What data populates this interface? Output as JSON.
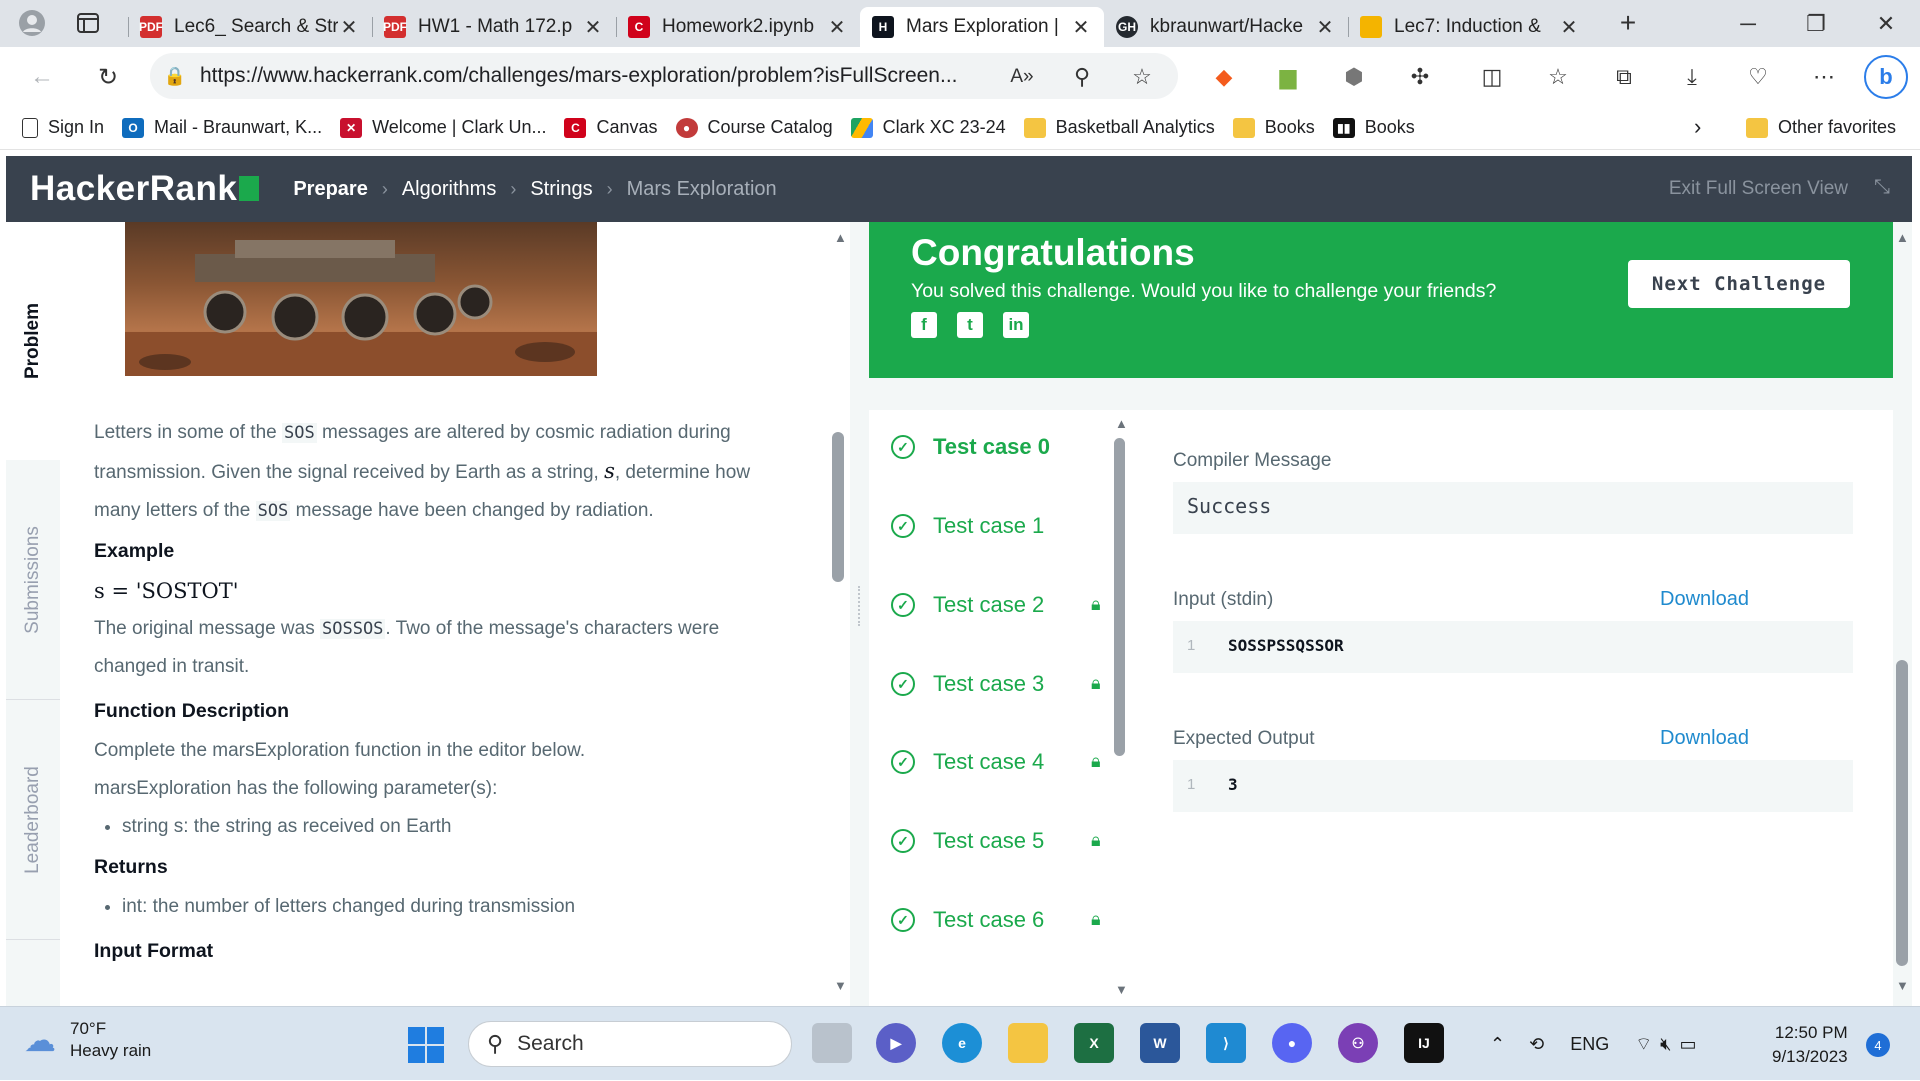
{
  "browser": {
    "tabs": [
      {
        "title": "Lec6_ Search & Str",
        "favicon": "PDF",
        "color": "#d32f2f"
      },
      {
        "title": "HW1 - Math 172.p",
        "favicon": "PDF",
        "color": "#d32f2f"
      },
      {
        "title": "Homework2.ipynb",
        "favicon": "C",
        "color": "#d0021b"
      },
      {
        "title": "Mars Exploration |",
        "favicon": "H",
        "color": "#0e141e"
      },
      {
        "title": "kbraunwart/Hacke",
        "favicon": "GH",
        "color": "#24292f"
      },
      {
        "title": "Lec7: Induction &",
        "favicon": "",
        "color": "#f4b400"
      }
    ],
    "url": "https://www.hackerrank.com/challenges/mars-exploration/problem?isFullScreen...",
    "favorites": [
      {
        "label": "Sign In",
        "icon": "doc-icon",
        "color": "#ffffff"
      },
      {
        "label": "Mail - Braunwart, K...",
        "icon": "outlook-icon",
        "color": "#0f6cbd"
      },
      {
        "label": "Welcome | Clark Un...",
        "icon": "clark-icon",
        "color": "#c8102e"
      },
      {
        "label": "Canvas",
        "icon": "canvas-icon",
        "color": "#d0021b"
      },
      {
        "label": "Course Catalog",
        "icon": "catalog-icon",
        "color": "#c23b3b"
      },
      {
        "label": "Clark XC 23-24",
        "icon": "drive-icon",
        "color": "#1ea362"
      },
      {
        "label": "Basketball Analytics",
        "icon": "folder-icon",
        "color": "#f4c542"
      },
      {
        "label": "Books",
        "icon": "folder-icon",
        "color": "#f4c542"
      },
      {
        "label": "Books",
        "icon": "books-icon",
        "color": "#111111"
      }
    ],
    "other_favorites": "Other favorites"
  },
  "header": {
    "logo": "HackerRank",
    "crumbs": [
      "Prepare",
      "Algorithms",
      "Strings",
      "Mars Exploration"
    ],
    "exit_fullscreen": "Exit Full Screen View"
  },
  "sidenav": {
    "problem": "Problem",
    "submissions": "Submissions",
    "leaderboard": "Leaderboard"
  },
  "problem": {
    "p1_a": "Letters in some of the ",
    "p1_code1": "SOS",
    "p1_b": " messages are altered by cosmic radiation during transmission. Given the signal received by Earth as a string, ",
    "p1_var": "s",
    "p1_c": ", determine how many letters of the ",
    "p1_code2": "SOS",
    "p1_d": " message have been changed by radiation.",
    "example_heading": "Example",
    "example_math": "s = 'SOSTOT'",
    "p2_a": "The original message was ",
    "p2_code": "SOSSOS",
    "p2_b": ". Two of the message's characters were changed in transit.",
    "func_heading": "Function Description",
    "func_text": "Complete the marsExploration function in the editor below.",
    "params_text": "marsExploration has the following parameter(s):",
    "param_item": "string s: the string as received on Earth",
    "returns_heading": "Returns",
    "returns_item": "int: the number of letters changed during transmission",
    "input_heading": "Input Format"
  },
  "congrats": {
    "title": "Congratulations",
    "message": "You solved this challenge. Would you like to challenge your friends?",
    "next_button": "Next Challenge"
  },
  "test_cases": [
    "Test case 0",
    "Test case 1",
    "Test case 2",
    "Test case 3",
    "Test case 4",
    "Test case 5",
    "Test case 6"
  ],
  "result": {
    "compiler_label": "Compiler Message",
    "compiler_value": "Success",
    "input_label": "Input (stdin)",
    "input_download": "Download",
    "input_line": "1",
    "input_value": "SOSSPSSQSSOR",
    "expected_label": "Expected Output",
    "expected_download": "Download",
    "expected_line": "1",
    "expected_value": "3"
  },
  "taskbar": {
    "temp": "70°F",
    "weather": "Heavy rain",
    "search": "Search",
    "lang": "ENG",
    "time": "12:50 PM",
    "date": "9/13/2023",
    "notifications": "4"
  }
}
